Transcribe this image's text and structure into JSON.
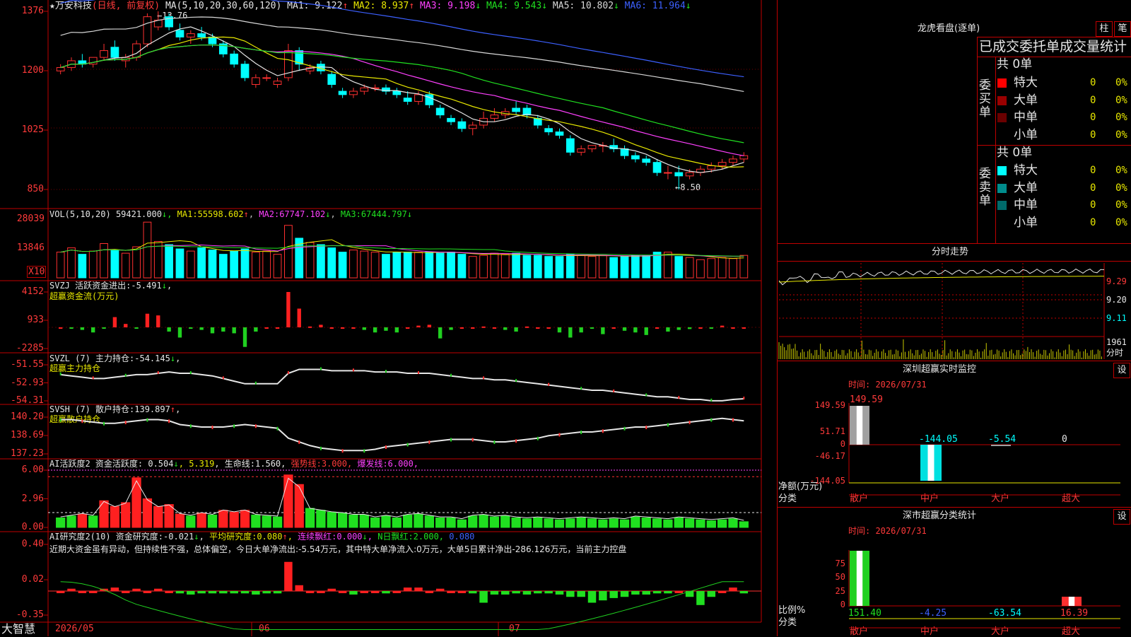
{
  "stock_title": "★万安科技",
  "stock_mode": "(日线, 前复权)",
  "ma_label": "MA(5,10,20,30,60,120)",
  "ma_values": [
    {
      "label": "MA1:",
      "value": "9.122",
      "arrow": "↑",
      "color": "#e6e6e6"
    },
    {
      "label": "MA2:",
      "value": "8.937",
      "arrow": "↑",
      "color": "#e8e800"
    },
    {
      "label": "MA3:",
      "value": "9.198",
      "arrow": "↓",
      "color": "#ff40ff"
    },
    {
      "label": "MA4:",
      "value": "9.543",
      "arrow": "↓",
      "color": "#20e020"
    },
    {
      "label": "MA5:",
      "value": "10.802",
      "arrow": "↓",
      "color": "#d8d8d8"
    },
    {
      "label": "MA6:",
      "value": "11.964",
      "arrow": "↓",
      "color": "#3c60ff"
    }
  ],
  "price_axis": [
    "1376",
    "1200",
    "1025",
    "850"
  ],
  "price_high_mark": "13.76",
  "price_low_mark": "8.50",
  "vol_header": {
    "label": "VOL(5,10,20)",
    "value": "59421.000",
    "ma1": "55598.602",
    "ma2": "67747.102",
    "ma3": "67444.797"
  },
  "vol_axis": [
    "28039",
    "13846"
  ],
  "vol_unit": "X10",
  "svzj_header": {
    "label": "SVZJ  活跃资金进出:",
    "value": "-5.491",
    "arrow": "↓",
    "sub": "超赢资金流(万元)"
  },
  "svzj_axis": [
    "4152",
    "933",
    "-2285"
  ],
  "svzl_header": {
    "label": "SVZL (7) 主力持仓:",
    "value": "-54.145",
    "arrow": "↓",
    "sub": "超赢主力持仓"
  },
  "svzl_axis": [
    "-51.55",
    "-52.93",
    "-54.31"
  ],
  "svsh_header": {
    "label": "SVSH (7) 散户持仓:",
    "value": "139.897",
    "arrow": "↑",
    "sub": "超赢散户持仓"
  },
  "svsh_axis": [
    "140.20",
    "138.69",
    "137.23"
  ],
  "ai1_header": {
    "label": "AI活跃度2 资金活跃度:",
    "v1": "0.504",
    "v2": "5.319",
    "life_label": "生命线:",
    "life": "1.560",
    "strong_label": "强势线:",
    "strong": "3.000",
    "burst_label": "爆发线:",
    "burst": "6.000"
  },
  "ai1_axis": [
    "6.00",
    "2.96",
    "0.00"
  ],
  "ai2_header": {
    "label": "AI研究度2(10) 资金研究度:",
    "v1": "-0.021",
    "avg_label": "平均研究度:",
    "avg": "0.080",
    "red_label": "连续飘红:",
    "red": "0.000",
    "n_label": "N日飘红:",
    "n": "2.000",
    "last": "0.080"
  },
  "ai2_text": "近期大资金虽有异动，但持续性不强，总体偏空，今日大单净流出:-5.54万元，其中特大单净流入:0万元，大单5日累计净出-286.126万元，当前主力控盘",
  "ai2_axis": [
    "0.40",
    "0.02",
    "-0.35"
  ],
  "date_axis": [
    "2026/05",
    "06",
    "07"
  ],
  "brand": "大智慧",
  "right": {
    "lhb_title": "龙虎看盘(逐单)",
    "btn_bar": "柱",
    "btn_pen": "笔",
    "stats_title": "已成交委托单成交量统计",
    "buy_label": "委买单",
    "sell_label": "委卖单",
    "buy_total": "共 0单",
    "sell_total": "共 0单",
    "buy_rows": [
      {
        "name": "特大",
        "count": "0",
        "pct": "0%",
        "color": "#ff0000"
      },
      {
        "name": "大单",
        "count": "0",
        "pct": "0%",
        "color": "#9a0000"
      },
      {
        "name": "中单",
        "count": "0",
        "pct": "0%",
        "color": "#6a0000"
      },
      {
        "name": "小单",
        "count": "0",
        "pct": "0%",
        "color": ""
      }
    ],
    "sell_rows": [
      {
        "name": "特大",
        "count": "0",
        "pct": "0%",
        "color": "#00ffff"
      },
      {
        "name": "大单",
        "count": "0",
        "pct": "0%",
        "color": "#008c8c"
      },
      {
        "name": "中单",
        "count": "0",
        "pct": "0%",
        "color": "#006a6a"
      },
      {
        "name": "小单",
        "count": "0",
        "pct": "0%",
        "color": ""
      }
    ],
    "intraday_title": "分时走势",
    "intraday_axis": [
      "9.29",
      "9.20",
      "9.11"
    ],
    "intraday_vol": "1961",
    "intraday_vol_unit": "分时",
    "sz_title": "深圳超赢实时监控",
    "sz_btn": "设",
    "sz_time": "时间: 2026/07/31",
    "sz_axis": [
      "149.59",
      "51.71",
      "0",
      "-46.17",
      "-144.05"
    ],
    "sz_values": [
      "149.59",
      "-144.05",
      "-5.54",
      "0"
    ],
    "sz_ylabel": "净额(万元)",
    "sz_xlabel": "分类",
    "sz_cats": [
      "散户",
      "中户",
      "大户",
      "超大"
    ],
    "cls_title": "深市超赢分类统计",
    "cls_btn": "设",
    "cls_time": "时间: 2026/07/31",
    "cls_axis": [
      "75",
      "50",
      "25",
      "0"
    ],
    "cls_ylabel": "比例%",
    "cls_xlabel": "分类",
    "cls_values": [
      "151.40",
      "-4.25",
      "-63.54",
      "16.39"
    ],
    "cls_cats": [
      "散户",
      "中户",
      "大户",
      "超大"
    ]
  },
  "chart_data": [
    {
      "type": "candlestick",
      "title": "万安科技 (日线, 前复权)",
      "x_labels": [
        "2026/05",
        "06",
        "07"
      ],
      "ylim": [
        8.3,
        13.9
      ],
      "ohlc": [
        [
          12.0,
          12.2,
          11.9,
          12.1
        ],
        [
          12.1,
          12.4,
          12.0,
          12.3
        ],
        [
          12.3,
          12.5,
          12.1,
          12.2
        ],
        [
          12.2,
          12.4,
          12.1,
          12.4
        ],
        [
          12.4,
          12.8,
          12.3,
          12.6
        ],
        [
          12.7,
          12.9,
          12.3,
          12.4
        ],
        [
          12.3,
          12.5,
          12.1,
          12.4
        ],
        [
          12.4,
          12.9,
          12.3,
          12.8
        ],
        [
          12.8,
          13.7,
          12.7,
          13.6
        ],
        [
          13.3,
          13.76,
          13.2,
          13.5
        ],
        [
          13.6,
          13.7,
          13.2,
          13.3
        ],
        [
          13.2,
          13.4,
          12.9,
          13.0
        ],
        [
          13.0,
          13.2,
          12.8,
          13.1
        ],
        [
          13.1,
          13.3,
          12.9,
          13.0
        ],
        [
          13.0,
          13.1,
          12.7,
          12.8
        ],
        [
          12.8,
          12.9,
          12.4,
          12.5
        ],
        [
          12.5,
          12.6,
          12.1,
          12.2
        ],
        [
          12.2,
          12.3,
          11.7,
          11.8
        ],
        [
          11.6,
          11.9,
          11.5,
          11.8
        ],
        [
          11.8,
          11.9,
          11.7,
          11.8
        ],
        [
          11.6,
          11.8,
          11.5,
          11.7
        ],
        [
          11.8,
          12.8,
          11.7,
          12.6
        ],
        [
          12.6,
          12.7,
          12.0,
          12.2
        ],
        [
          12.0,
          12.2,
          11.9,
          12.1
        ],
        [
          12.2,
          12.3,
          11.9,
          12.0
        ],
        [
          11.9,
          12.0,
          11.5,
          11.6
        ],
        [
          11.4,
          11.5,
          11.2,
          11.3
        ],
        [
          11.3,
          11.5,
          11.2,
          11.4
        ],
        [
          11.4,
          11.6,
          11.3,
          11.5
        ],
        [
          11.5,
          11.6,
          11.4,
          11.5
        ],
        [
          11.5,
          11.6,
          11.3,
          11.4
        ],
        [
          11.4,
          11.5,
          11.2,
          11.3
        ],
        [
          11.2,
          11.4,
          11.0,
          11.1
        ],
        [
          11.1,
          11.4,
          11.0,
          11.3
        ],
        [
          11.3,
          11.4,
          10.9,
          11.0
        ],
        [
          10.9,
          11.0,
          10.6,
          10.7
        ],
        [
          10.6,
          10.7,
          10.4,
          10.5
        ],
        [
          10.5,
          10.6,
          10.2,
          10.3
        ],
        [
          10.3,
          10.5,
          10.1,
          10.4
        ],
        [
          10.4,
          10.8,
          10.3,
          10.6
        ],
        [
          10.6,
          10.9,
          10.5,
          10.7
        ],
        [
          10.7,
          10.9,
          10.6,
          10.8
        ],
        [
          10.9,
          11.1,
          10.7,
          10.8
        ],
        [
          10.9,
          11.0,
          10.6,
          10.7
        ],
        [
          10.6,
          10.7,
          10.3,
          10.4
        ],
        [
          10.3,
          10.4,
          10.1,
          10.2
        ],
        [
          10.2,
          10.3,
          10.0,
          10.1
        ],
        [
          10.0,
          10.1,
          9.5,
          9.6
        ],
        [
          9.6,
          9.8,
          9.5,
          9.7
        ],
        [
          9.7,
          9.8,
          9.6,
          9.8
        ],
        [
          9.8,
          9.9,
          9.6,
          9.8
        ],
        [
          9.8,
          10.0,
          9.6,
          9.7
        ],
        [
          9.7,
          9.8,
          9.4,
          9.5
        ],
        [
          9.5,
          9.6,
          9.3,
          9.4
        ],
        [
          9.4,
          9.5,
          9.2,
          9.3
        ],
        [
          9.3,
          9.4,
          8.9,
          9.0
        ],
        [
          9.0,
          9.2,
          8.8,
          9.0
        ],
        [
          9.0,
          9.2,
          8.5,
          8.9
        ],
        [
          8.9,
          9.1,
          8.8,
          9.0
        ],
        [
          9.0,
          9.2,
          8.9,
          9.1
        ],
        [
          9.1,
          9.3,
          9.0,
          9.2
        ],
        [
          9.2,
          9.4,
          9.1,
          9.3
        ],
        [
          9.3,
          9.5,
          9.2,
          9.4
        ],
        [
          9.4,
          9.6,
          9.3,
          9.5
        ]
      ],
      "ma_lines": [
        {
          "name": "MA1",
          "color": "#e6e6e6",
          "start": 12.1,
          "end": 9.12
        },
        {
          "name": "MA2",
          "color": "#e8e800",
          "start": 12.0,
          "end": 8.94
        },
        {
          "name": "MA3",
          "color": "#ff40ff",
          "start": 12.1,
          "end": 9.2
        },
        {
          "name": "MA4",
          "color": "#20e020",
          "start": 12.2,
          "end": 9.54
        },
        {
          "name": "MA5",
          "color": "#d8d8d8",
          "start": 12.9,
          "end": 10.8
        },
        {
          "name": "MA6",
          "color": "#3c60ff",
          "start": 13.6,
          "end": 11.96
        }
      ]
    },
    {
      "type": "bar",
      "title": "VOL(5,10,20)",
      "ylim": [
        0,
        28039
      ],
      "values": [
        12000,
        14000,
        11000,
        12500,
        16000,
        13000,
        11500,
        14500,
        26000,
        17000,
        15500,
        13500,
        12500,
        14000,
        13000,
        11000,
        12500,
        13500,
        12000,
        12500,
        11000,
        24500,
        18500,
        16500,
        15500,
        14000,
        12000,
        13000,
        12500,
        12000,
        11000,
        12000,
        12000,
        12000,
        12000,
        11500,
        12000,
        11000,
        10000,
        10500,
        11500,
        11000,
        11500,
        10500,
        10500,
        10000,
        10000,
        11000,
        10500,
        10000,
        10500,
        9500,
        10000,
        10500,
        10500,
        12000,
        12000,
        10000,
        9500,
        8500,
        9000,
        9500,
        9000,
        10500
      ]
    },
    {
      "type": "bar",
      "title": "超赢资金流(万元)",
      "ylim": [
        -2285,
        4152
      ],
      "values": [
        0,
        -100,
        -300,
        -600,
        -100,
        1200,
        400,
        -100,
        1600,
        1400,
        -500,
        -1200,
        -100,
        -300,
        -700,
        -500,
        -700,
        -2300,
        -500,
        0,
        0,
        4152,
        2200,
        100,
        300,
        0,
        0,
        0,
        -300,
        -600,
        -400,
        -600,
        0,
        200,
        300,
        -1300,
        -300,
        0,
        0,
        100,
        0,
        -300,
        -500,
        100,
        0,
        0,
        -600,
        -1200,
        -600,
        -100,
        -800,
        0,
        -400,
        -600,
        -900,
        0,
        -500,
        -300,
        -200,
        0,
        -100,
        200,
        0,
        0
      ]
    },
    {
      "type": "line",
      "title": "超赢主力持仓",
      "ylim": [
        -54.31,
        -51.55
      ],
      "values": [
        -52.3,
        -52.4,
        -52.5,
        -52.6,
        -52.6,
        -52.5,
        -52.4,
        -52.3,
        -52.3,
        -52.2,
        -52.1,
        -52.2,
        -52.2,
        -52.3,
        -52.4,
        -52.6,
        -52.8,
        -53.0,
        -53.0,
        -53.0,
        -53.0,
        -52.2,
        -51.9,
        -51.9,
        -51.9,
        -52.0,
        -52.0,
        -52.0,
        -52.0,
        -52.1,
        -52.1,
        -52.1,
        -52.2,
        -52.2,
        -52.2,
        -52.3,
        -52.4,
        -52.5,
        -52.6,
        -52.6,
        -52.7,
        -52.7,
        -52.8,
        -52.9,
        -53.0,
        -53.1,
        -53.2,
        -53.3,
        -53.4,
        -53.5,
        -53.5,
        -53.6,
        -53.7,
        -53.8,
        -53.9,
        -54.0,
        -54.0,
        -54.1,
        -54.2,
        -54.2,
        -54.3,
        -54.3,
        -54.2,
        -54.15
      ]
    },
    {
      "type": "line",
      "title": "超赢散户持仓",
      "ylim": [
        137.23,
        140.2
      ],
      "values": [
        140.0,
        140.0,
        139.9,
        139.8,
        139.7,
        139.7,
        139.8,
        139.9,
        140.0,
        140.0,
        139.9,
        139.6,
        139.5,
        139.4,
        139.4,
        139.4,
        139.5,
        139.6,
        139.5,
        139.4,
        139.3,
        138.5,
        138.2,
        137.9,
        137.7,
        137.6,
        137.5,
        137.5,
        137.5,
        137.6,
        137.8,
        137.9,
        138.0,
        138.1,
        138.2,
        138.3,
        138.4,
        138.4,
        138.4,
        138.3,
        138.2,
        138.2,
        138.3,
        138.4,
        138.5,
        138.7,
        138.8,
        138.9,
        139.0,
        139.0,
        139.1,
        139.2,
        139.3,
        139.4,
        139.4,
        139.5,
        139.6,
        139.7,
        139.8,
        139.9,
        140.0,
        140.1,
        140.0,
        139.9
      ]
    },
    {
      "type": "bar",
      "title": "AI活跃度2 资金活跃度",
      "ylim": [
        0,
        6
      ],
      "values": [
        1.0,
        1.2,
        1.4,
        1.2,
        2.8,
        2.2,
        2.6,
        5.2,
        3.0,
        2.2,
        2.4,
        1.4,
        1.2,
        1.5,
        1.3,
        1.8,
        1.6,
        1.8,
        1.3,
        1.2,
        1.1,
        5.5,
        4.5,
        2.0,
        1.8,
        1.6,
        1.5,
        1.3,
        1.3,
        1.0,
        1.2,
        1.0,
        1.3,
        1.4,
        1.2,
        1.0,
        1.0,
        0.8,
        1.2,
        1.3,
        1.1,
        1.2,
        1.0,
        0.9,
        1.0,
        0.9,
        0.8,
        0.9,
        1.0,
        0.9,
        0.8,
        0.9,
        0.8,
        1.1,
        1.0,
        0.9,
        0.8,
        1.0,
        0.9,
        0.8,
        0.7,
        0.8,
        0.9,
        0.6
      ]
    },
    {
      "type": "bar",
      "title": "AI研究度2(10) 资金研究度",
      "ylim": [
        -0.35,
        0.4
      ],
      "values": [
        0.0,
        0.02,
        0.0,
        0.0,
        0.02,
        0.03,
        0.0,
        0.02,
        0.0,
        0.02,
        0.0,
        -0.02,
        -0.03,
        -0.02,
        -0.02,
        -0.02,
        -0.02,
        -0.02,
        -0.03,
        -0.02,
        -0.02,
        0.25,
        0.05,
        0.0,
        0.0,
        0.02,
        0.0,
        -0.03,
        0.0,
        0.0,
        -0.02,
        0.0,
        0.03,
        0.03,
        0.0,
        0.02,
        0.0,
        0.0,
        -0.02,
        -0.1,
        -0.03,
        -0.03,
        -0.02,
        -0.03,
        -0.02,
        -0.02,
        -0.03,
        -0.05,
        -0.05,
        -0.1,
        -0.08,
        -0.06,
        -0.05,
        -0.03,
        -0.03,
        -0.02,
        -0.02,
        0.0,
        -0.05,
        -0.12,
        -0.05,
        0.0,
        0.03,
        -0.02
      ]
    }
  ]
}
